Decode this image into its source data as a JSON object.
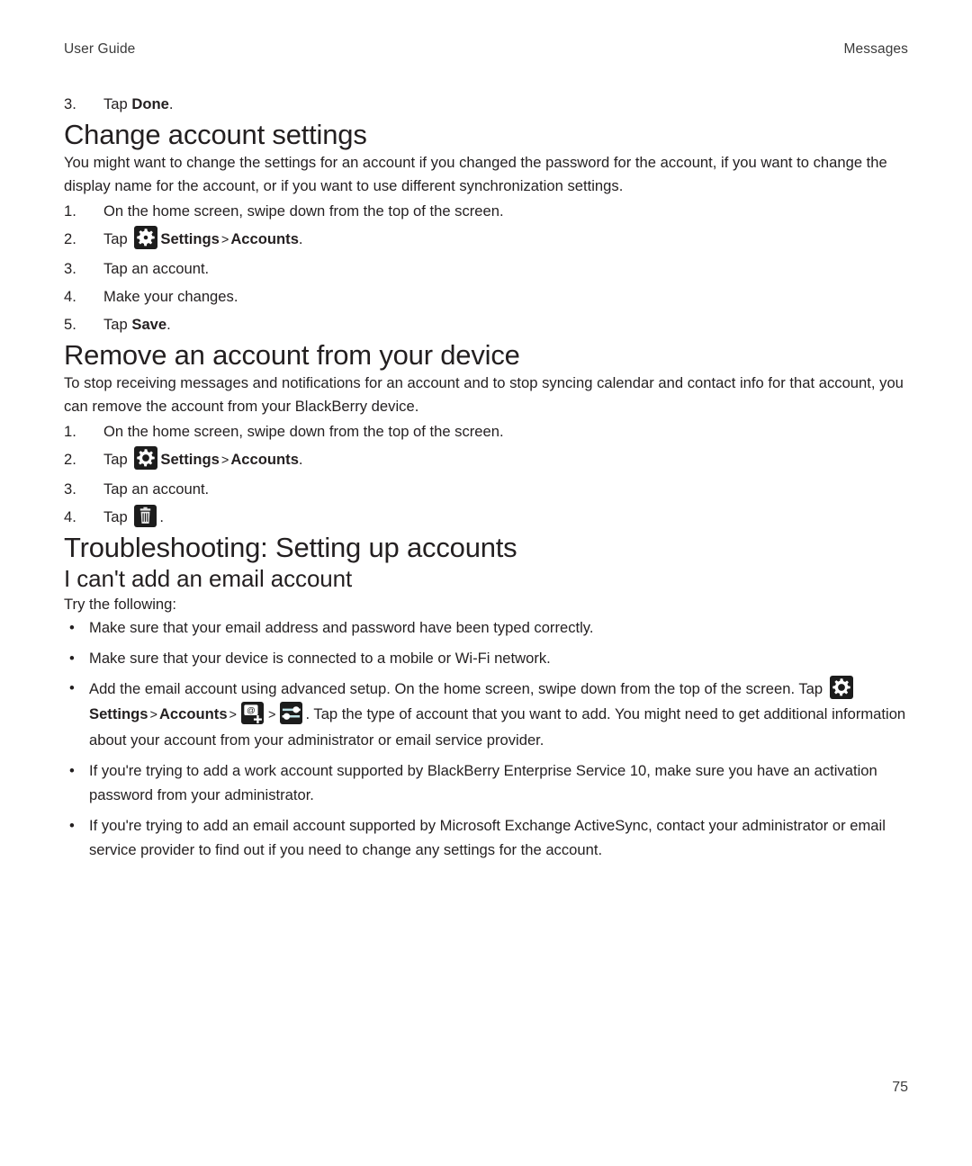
{
  "header": {
    "left": "User Guide",
    "right": "Messages"
  },
  "intro_step": {
    "num": "3.",
    "text_before": "Tap ",
    "bold": "Done",
    "text_after": "."
  },
  "sections": [
    {
      "heading": "Change account settings",
      "paragraph": "You might want to change the settings for an account if you changed the password for the account, if you want to change the display name for the account, or if you want to use different synchronization settings.",
      "steps": [
        {
          "num": "1.",
          "text": "On the home screen, swipe down from the top of the screen."
        },
        {
          "num": "2.",
          "prefix": "Tap ",
          "icon": "settings-gear-icon",
          "bold1": "Settings",
          "sep": ">",
          "bold2": "Accounts",
          "suffix": "."
        },
        {
          "num": "3.",
          "text": "Tap an account."
        },
        {
          "num": "4.",
          "text": "Make your changes."
        },
        {
          "num": "5.",
          "prefix": "Tap ",
          "bold1": "Save",
          "suffix": "."
        }
      ]
    },
    {
      "heading": "Remove an account from your device",
      "paragraph": "To stop receiving messages and notifications for an account and to stop syncing calendar and contact info for that account, you can remove the account from your BlackBerry device.",
      "steps": [
        {
          "num": "1.",
          "text": "On the home screen, swipe down from the top of the screen."
        },
        {
          "num": "2.",
          "prefix": "Tap ",
          "icon": "settings-gear-icon",
          "bold1": "Settings",
          "sep": ">",
          "bold2": "Accounts",
          "suffix": "."
        },
        {
          "num": "3.",
          "text": "Tap an account."
        },
        {
          "num": "4.",
          "prefix": "Tap ",
          "icon": "delete-trash-icon",
          "suffix": "."
        }
      ]
    }
  ],
  "troubleshooting": {
    "heading": "Troubleshooting: Setting up accounts",
    "subheading": "I can't add an email account",
    "lead": "Try the following:",
    "bullets": [
      {
        "bullet": "•",
        "text": "Make sure that your email address and password have been typed correctly."
      },
      {
        "bullet": "•",
        "text": "Make sure that your device is connected to a mobile or Wi-Fi network."
      },
      {
        "bullet": "•",
        "part1": "Add the email account using advanced setup. On the home screen, swipe down from the top of the screen. Tap ",
        "icon1": "settings-gear-icon",
        "bold1": "Settings",
        "sep1": ">",
        "bold2": "Accounts",
        "sep2": ">",
        "icon2": "add-email-account-icon",
        "sep3": ">",
        "icon3": "advanced-setup-sliders-icon",
        "part2": ". Tap the type of account that you want to add. You might need to get additional information about your account from your administrator or email service provider."
      },
      {
        "bullet": "•",
        "text": "If you're trying to add a work account supported by BlackBerry Enterprise Service 10, make sure you have an activation password from your administrator."
      },
      {
        "bullet": "•",
        "text": "If you're trying to add an email account supported by Microsoft Exchange ActiveSync, contact your administrator or email service provider to find out if you need to change any settings for the account."
      }
    ]
  },
  "footer": {
    "page_number": "75"
  },
  "colors": {
    "text": "#231f20",
    "muted": "#3b3b3b",
    "icon_background": "#1c1c1c",
    "icon_glyph": "#ffffff",
    "page_background": "#ffffff"
  }
}
